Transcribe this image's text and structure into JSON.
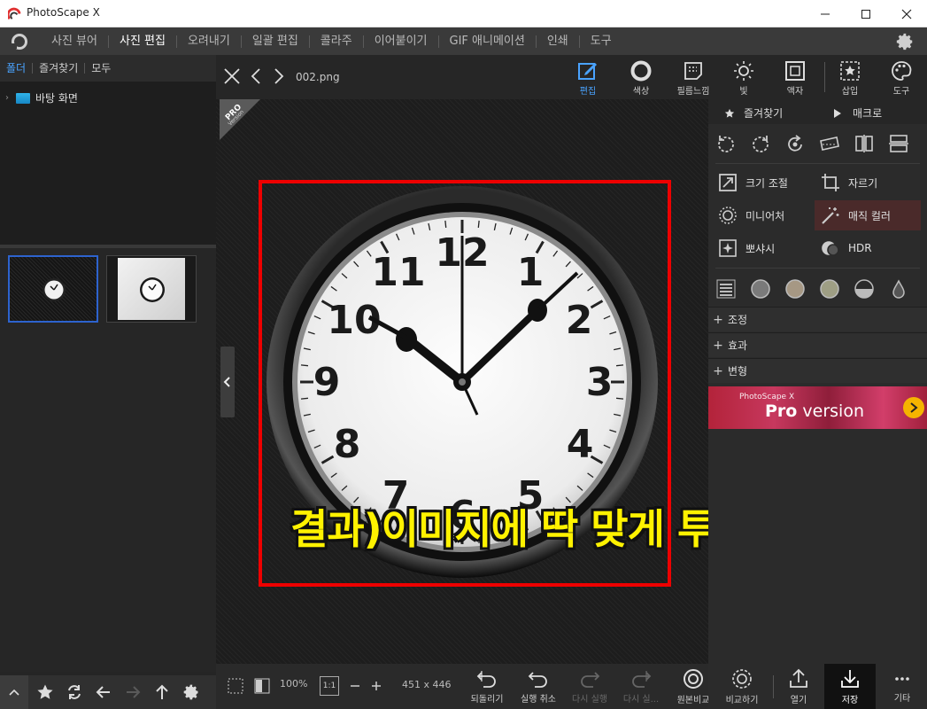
{
  "window": {
    "title": "PhotoScape X"
  },
  "menu": {
    "items": [
      "사진 뷰어",
      "사진 편집",
      "오려내기",
      "일괄 편집",
      "콜라주",
      "이어붙이기",
      "GIF 애니메이션",
      "인쇄",
      "도구"
    ],
    "active_index": 1
  },
  "left_panel": {
    "tabs": [
      "폴더",
      "즐겨찾기",
      "모두"
    ],
    "active_tab": "폴더",
    "tree_item": "바탕 화면"
  },
  "viewer": {
    "filename": "002.png",
    "pro_badge": "PRO",
    "pro_badge_sub": "Version",
    "overlay_caption": "결과)이미지에 딱 맞게 투명 여백이 잘림",
    "zoom": "100%",
    "zoom_one": "1:1",
    "image_size": "451 x 446"
  },
  "top_tools": [
    {
      "label": "편집",
      "icon": "edit-icon",
      "active": true
    },
    {
      "label": "색상",
      "icon": "color-icon"
    },
    {
      "label": "필름느낌",
      "icon": "film-icon"
    },
    {
      "label": "빛",
      "icon": "light-icon"
    },
    {
      "label": "액자",
      "icon": "frame-icon"
    },
    {
      "label": "삽입",
      "icon": "insert-icon"
    },
    {
      "label": "도구",
      "icon": "palette-icon"
    }
  ],
  "right_panel": {
    "favorites": "즐겨찾기",
    "macro": "매크로",
    "tools": {
      "resize": "크기 조절",
      "crop": "자르기",
      "miniature": "미니어처",
      "magic_color": "매직 컬러",
      "bokeh": "뽀샤시",
      "hdr": "HDR"
    },
    "sections": [
      "조정",
      "효과",
      "변형"
    ],
    "promo": {
      "small": "PhotoScape X",
      "pro": "Pro",
      "version": "version"
    }
  },
  "bottom_bar": {
    "undo_all": "되돌리기",
    "undo": "실행 취소",
    "redo": "다시 실행",
    "redo_all": "다시 실...",
    "original": "원본비교",
    "compare": "비교하기",
    "open": "열기",
    "save": "저장",
    "more": "기타"
  },
  "colors": {
    "accent_blue": "#4aa3ff",
    "selection_blue": "#2d63ce",
    "red_frame": "#ee0000",
    "caption_yellow": "#fff200"
  }
}
